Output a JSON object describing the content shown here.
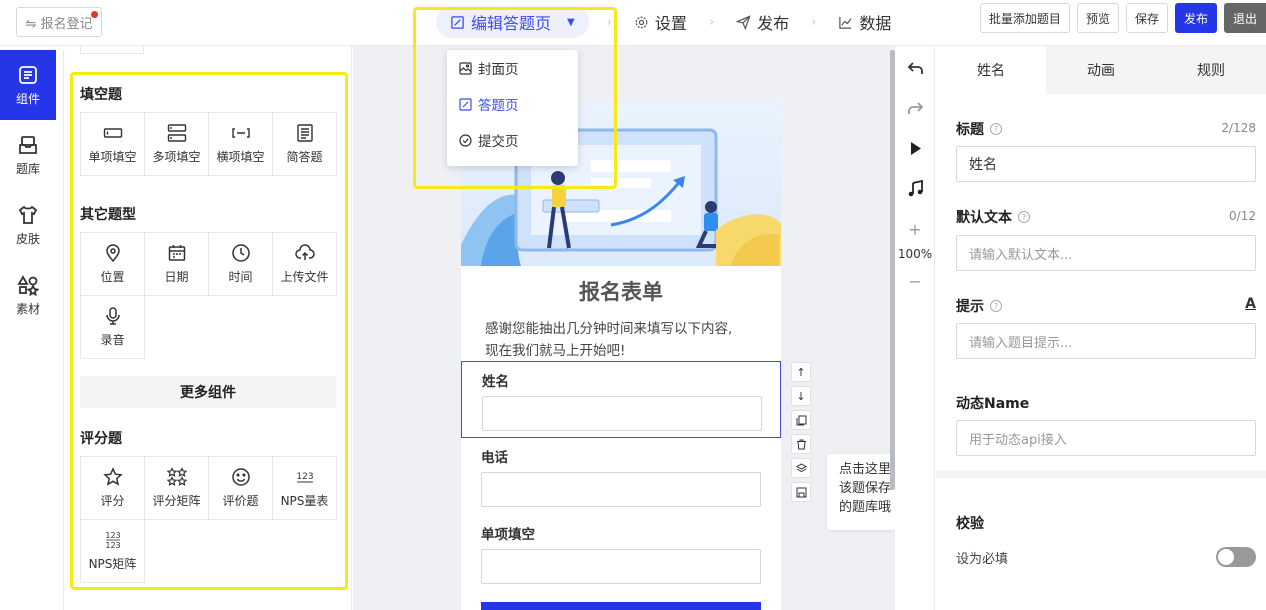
{
  "topbar": {
    "back_label": "⇋ 报名登记",
    "steps": [
      {
        "label": "编辑答题页",
        "active": true
      },
      {
        "label": "设置"
      },
      {
        "label": "发布"
      },
      {
        "label": "数据"
      }
    ],
    "actions": {
      "batch_add": "批量添加题目",
      "preview": "预览",
      "save": "保存",
      "publish": "发布",
      "exit": "退出"
    }
  },
  "dropdown": {
    "items": [
      {
        "label": "封面页",
        "icon": "image-icon"
      },
      {
        "label": "答题页",
        "icon": "edit-icon",
        "active": true
      },
      {
        "label": "提交页",
        "icon": "check-circle-icon"
      }
    ]
  },
  "leftnav": {
    "items": [
      {
        "label": "组件",
        "icon": "component-icon",
        "active": true
      },
      {
        "label": "题库",
        "icon": "inbox-icon"
      },
      {
        "label": "皮肤",
        "icon": "tshirt-icon"
      },
      {
        "label": "素材",
        "icon": "shapes-icon"
      }
    ]
  },
  "components": {
    "fill_title": "填空题",
    "fill_items": [
      {
        "label": "单项填空",
        "icon": "single-input-icon"
      },
      {
        "label": "多项填空",
        "icon": "multi-input-icon"
      },
      {
        "label": "横项填空",
        "icon": "horizontal-input-icon"
      },
      {
        "label": "简答题",
        "icon": "text-lines-icon"
      }
    ],
    "other_title": "其它题型",
    "other_items": [
      {
        "label": "位置",
        "icon": "location-icon"
      },
      {
        "label": "日期",
        "icon": "calendar-icon"
      },
      {
        "label": "时间",
        "icon": "clock-icon"
      },
      {
        "label": "上传文件",
        "icon": "cloud-upload-icon"
      },
      {
        "label": "录音",
        "icon": "microphone-icon"
      }
    ],
    "more_label": "更多组件",
    "rating_title": "评分题",
    "rating_items": [
      {
        "label": "评分",
        "icon": "star-icon"
      },
      {
        "label": "评分矩阵",
        "icon": "star-matrix-icon"
      },
      {
        "label": "评价题",
        "icon": "smile-icon"
      },
      {
        "label": "NPS量表",
        "icon": "nps-icon"
      },
      {
        "label": "NPS矩阵",
        "icon": "nps-matrix-icon"
      }
    ]
  },
  "form": {
    "title": "报名表单",
    "desc_line1": "感谢您能抽出几分钟时间来填写以下内容,",
    "desc_line2": "现在我们就马上开始吧!",
    "questions": [
      {
        "label": "姓名",
        "selected": true
      },
      {
        "label": "电话"
      },
      {
        "label": "单项填空"
      }
    ],
    "tooltip_lines": [
      "点击这里",
      "该题保存",
      "的题库哦"
    ]
  },
  "toolcol": {
    "zoom": "100%"
  },
  "props": {
    "tabs": [
      "姓名",
      "动画",
      "规则"
    ],
    "title_label": "标题",
    "title_count": "2/128",
    "title_value": "姓名",
    "default_label": "默认文本",
    "default_count": "0/12",
    "default_placeholder": "请输入默认文本...",
    "hint_label": "提示",
    "hint_format": "A",
    "hint_placeholder": "请输入题目提示...",
    "dyn_label": "动态Name",
    "dyn_placeholder": "用于动态api接入",
    "validate_label": "校验",
    "required_label": "设为必填",
    "required_on": false
  },
  "colors": {
    "accent": "#2535e8",
    "highlight": "#f5ea17"
  }
}
